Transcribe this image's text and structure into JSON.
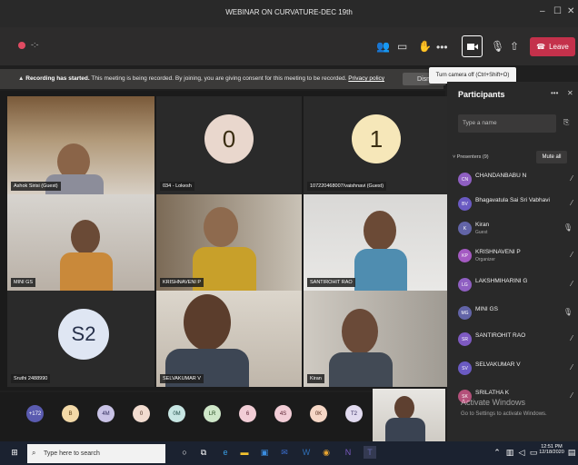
{
  "window": {
    "title": "WEBINAR ON CURVATURE-DEC 19th",
    "controls": [
      "–",
      "☐",
      "✕"
    ]
  },
  "toolbar": {
    "more_label": "•••",
    "leave_label": "Leave",
    "camera_tooltip": "Turn camera off (Ctrl+Shift+O)"
  },
  "banner": {
    "bold": "Recording has started.",
    "text": " This meeting is being recorded. By joining, you are giving consent for this meeting to be recorded. ",
    "link": "Privacy policy",
    "dismiss": "Dism"
  },
  "tiles": [
    {
      "name": "Ashok Sirisi (Guest)"
    },
    {
      "name": "034 - Lokesh",
      "initial": "0"
    },
    {
      "name": "107220468007/vaishnavi (Guest)",
      "initial": "1"
    },
    {
      "name": "MINI GS"
    },
    {
      "name": "KRISHNAVENI P"
    },
    {
      "name": "SANTIROHIT RAO"
    },
    {
      "name": "Sruthi 2488990",
      "initial": "S2"
    },
    {
      "name": "SELVAKUMAR V"
    },
    {
      "name": "Kiran"
    }
  ],
  "strip": [
    "+172",
    "B",
    "4M",
    "0",
    "0M",
    "LR",
    "6",
    "4S",
    "0K",
    "T2"
  ],
  "participants": {
    "title": "Participants",
    "search_placeholder": "Type a name",
    "section": "Presenters (9)",
    "mute_all": "Mute all",
    "list": [
      {
        "initials": "CN",
        "name": "CHANDANBABU N",
        "sub": "",
        "color": "#8f5fc2"
      },
      {
        "initials": "BV",
        "name": "Bhagavatula Sai Sri Vabhavi",
        "sub": "",
        "color": "#6a5ac2"
      },
      {
        "initials": "K",
        "name": "Kiran",
        "sub": "Guest",
        "color": "#6264a7"
      },
      {
        "initials": "KP",
        "name": "KRISHNAVENI P",
        "sub": "Organizer",
        "color": "#a45ac2"
      },
      {
        "initials": "LG",
        "name": "LAKSHMIHARINI G",
        "sub": "",
        "color": "#8f5fc2"
      },
      {
        "initials": "MG",
        "name": "MINI GS",
        "sub": "",
        "color": "#6264a7"
      },
      {
        "initials": "SR",
        "name": "SANTIROHIT RAO",
        "sub": "",
        "color": "#7e5ac2"
      },
      {
        "initials": "SV",
        "name": "SELVAKUMAR V",
        "sub": "",
        "color": "#6a5ac2"
      },
      {
        "initials": "SK",
        "name": "SRILATHA K",
        "sub": "",
        "color": "#b4507a"
      }
    ]
  },
  "watermark": {
    "line1": "Activate Windows",
    "line2": "Go to Settings to activate Windows."
  },
  "taskbar": {
    "search_placeholder": "Type here to search",
    "time": "12:51 PM",
    "date": "12/18/2020"
  }
}
